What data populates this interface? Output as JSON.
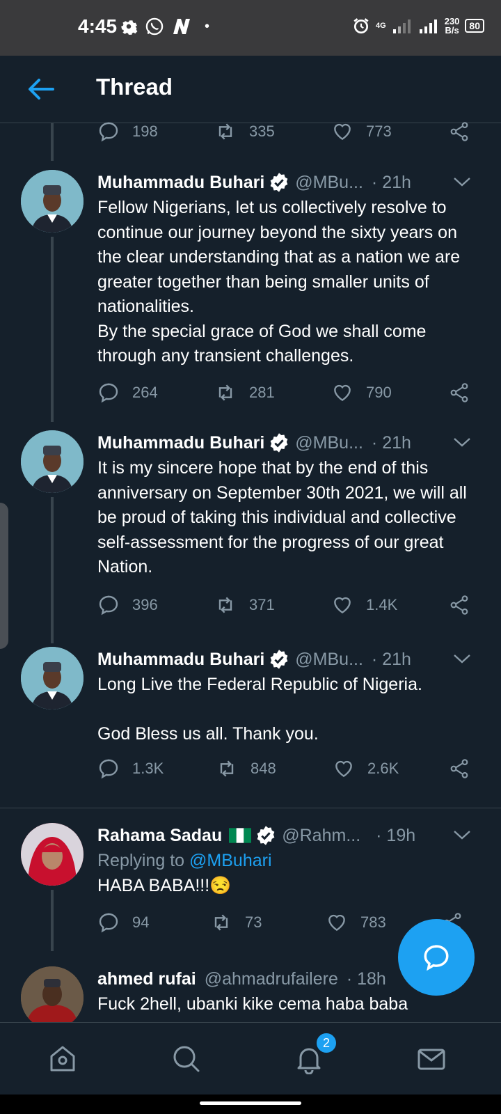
{
  "status_bar": {
    "time": "4:45",
    "speed_value": "230",
    "speed_unit": "B/s",
    "battery": "80",
    "network": "4G"
  },
  "header": {
    "title": "Thread"
  },
  "top_actions": {
    "replies": "198",
    "retweets": "335",
    "likes": "773"
  },
  "tweets": [
    {
      "name": "Muhammadu Buhari",
      "handle": "@MBu...",
      "time": "· 21h",
      "text": "Fellow Nigerians, let us collectively resolve to continue our journey beyond the sixty years on the clear understanding that as a nation we are greater together than being smaller units of nationalities.\nBy the special grace of God we shall come through any transient challenges.",
      "replies": "264",
      "retweets": "281",
      "likes": "790"
    },
    {
      "name": "Muhammadu Buhari",
      "handle": "@MBu...",
      "time": "· 21h",
      "text": "It is my sincere hope that by the end of this anniversary on September 30th 2021, we will all be proud of taking this individual and collective self-assessment for the progress of our great Nation.",
      "replies": "396",
      "retweets": "371",
      "likes": "1.4K"
    },
    {
      "name": "Muhammadu Buhari",
      "handle": "@MBu...",
      "time": "· 21h",
      "text": "Long Live the Federal Republic of Nigeria.\n\nGod Bless us all. Thank you.",
      "replies": "1.3K",
      "retweets": "848",
      "likes": "2.6K"
    },
    {
      "name": "Rahama Sadau",
      "handle": "@Rahm...",
      "time": "· 19h",
      "reply_prefix": "Replying to ",
      "reply_to": "@MBuhari",
      "text": "HABA BABA!!!😒",
      "replies": "94",
      "retweets": "73",
      "likes": "783"
    },
    {
      "name": "ahmed rufai",
      "handle": "@ahmadrufailere",
      "time": "· 18h",
      "text": "Fuck 2hell, ubanki kike cema haba baba"
    }
  ],
  "nav": {
    "notifications_badge": "2"
  },
  "colors": {
    "background": "#15202b",
    "accent": "#1da1f2",
    "muted": "#8899a6",
    "divider": "#38444d"
  }
}
